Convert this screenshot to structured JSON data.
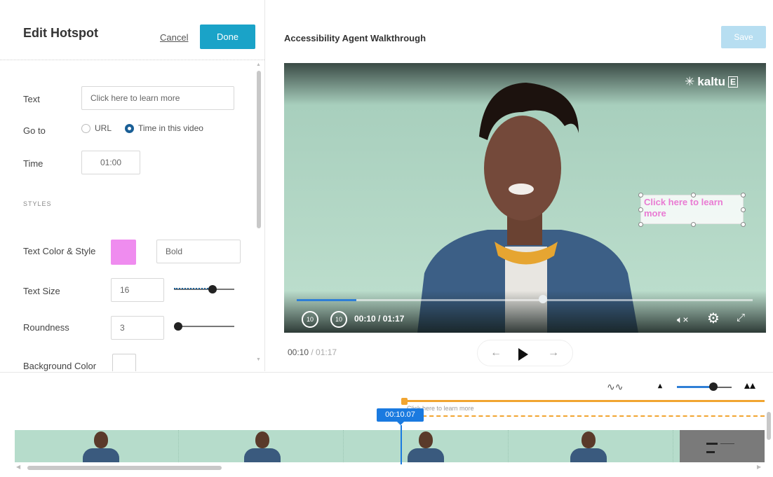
{
  "editor": {
    "title": "Edit Hotspot",
    "cancel_label": "Cancel",
    "done_label": "Done",
    "fields": {
      "text_label": "Text",
      "text_value": "Click here to learn more",
      "goto_label": "Go to",
      "goto_options": [
        "URL",
        "Time in this video"
      ],
      "goto_selected": "Time in this video",
      "time_label": "Time",
      "time_value": "01:00"
    },
    "styles_heading": "STYLES",
    "styles": {
      "text_color_style_label": "Text Color & Style",
      "text_color": "#ef8cef",
      "style_value": "Bold",
      "text_size_label": "Text Size",
      "text_size_value": "16",
      "text_size_slider_fraction": 0.75,
      "roundness_label": "Roundness",
      "roundness_value": "3",
      "roundness_slider_fraction": 0.05,
      "background_color_label": "Background Color"
    }
  },
  "video": {
    "title": "Accessibility Agent Walkthrough",
    "save_label": "Save",
    "logo_text": "kaltu",
    "hotspot_text": "Click here to learn more",
    "hotspot_color": "#e97bd3",
    "rewind_label": "10",
    "forward_label": "10",
    "time_overlay": "00:10 / 01:17",
    "progress_fraction": 0.13,
    "current_time": "00:10",
    "total_time": "/  01:17"
  },
  "timeline": {
    "hotspot_label": "Click here to learn more",
    "playhead_time": "00:10.07",
    "accent_color": "#1a7ae0",
    "hotspot_track_color": "#f1a531",
    "zoom_fraction": 0.67
  },
  "icons": [
    "settings-gear-icon",
    "volume-mute-icon",
    "fullscreen-icon",
    "rewind-10-icon",
    "forward-10-icon",
    "play-icon",
    "arrow-left-icon",
    "arrow-right-icon",
    "waveform-icon",
    "zoom-out-icon",
    "zoom-in-icon"
  ]
}
